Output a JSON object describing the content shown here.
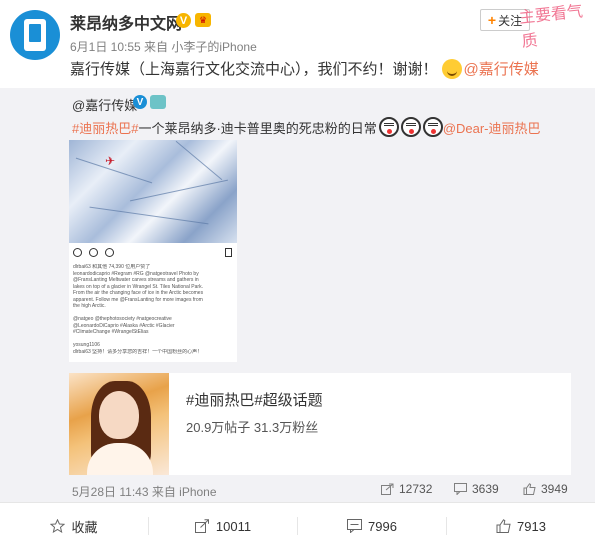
{
  "post": {
    "author": "莱昂纳多中文网",
    "meta": "6月1日 10:55 来自 小李子的iPhone",
    "follow_label": "关注",
    "watermark": "主要看气质",
    "text": "嘉行传媒（上海嘉行文化交流中心），我们不约！谢谢！",
    "mention": "@嘉行传媒"
  },
  "repost": {
    "author": "@嘉行传媒",
    "hashtag": "#迪丽热巴#",
    "text": " 一个莱昂纳多·迪卡普里奥的死忠粉的日常",
    "mention": "@Dear-迪丽热巴",
    "instagram": {
      "lines": [
        "dlrbai63 和其他 74,390 位用户赞了",
        "leonardodicaprio #Regram #RG @natgeotravel Photo by",
        "@FransLanting Meltwater carves streams and gathers in",
        "lakes on top of a glacier in Wrangel St. Tiles National Park.",
        "From the air the changing face of ice in the Arctic becomes",
        "apparent. Follow me @FransLanting for more images from",
        "the high Arctic.",
        "",
        "@natgeo @thephotosociety #natgeocreative",
        "@LeonardoDiCaprio #Alaska #Arctic #Glacier",
        "#ClimateChange #WrangelStElias",
        "",
        "yosung1106",
        "dlrbai63 坚持！请多分享您的吉祥！一个中国粉丝的心声！"
      ]
    },
    "topic": {
      "title": "#迪丽热巴#超级话题",
      "stats": "20.9万帖子 31.3万粉丝"
    },
    "date": "5月28日 11:43 来自 iPhone",
    "reposts": "12732",
    "comments": "3639",
    "likes": "3949"
  },
  "actions": {
    "favorite_label": "收藏",
    "repost_count": "10011",
    "comment_count": "7996",
    "like_count": "7913"
  },
  "colors": {
    "link": "#eb7350",
    "accent": "#ff8200",
    "repost_bg": "#f2f2f5"
  }
}
